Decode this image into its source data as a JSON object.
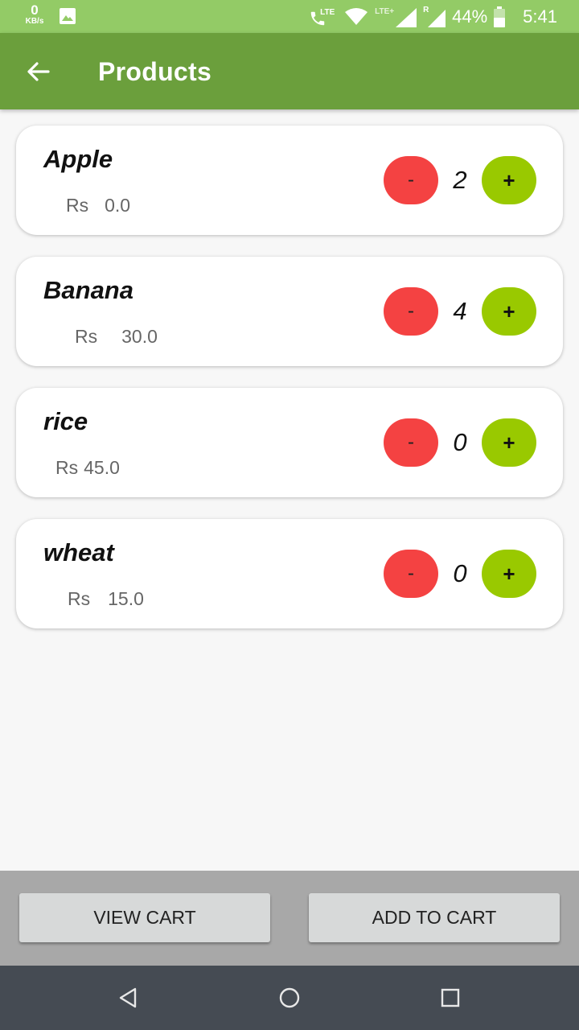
{
  "status_bar": {
    "kbs_value": "0",
    "kbs_unit": "KB/s",
    "lte_label": "LTE",
    "lte_plus_label": "LTE+",
    "roaming_label": "R",
    "battery": "44%",
    "time": "5:41",
    "icons": [
      "image-icon",
      "volte-call-icon",
      "wifi-icon",
      "signal-icon",
      "signal-roaming-icon",
      "battery-icon"
    ]
  },
  "app_bar": {
    "title": "Products",
    "back_icon": "arrow-left-icon"
  },
  "products": [
    {
      "name": "Apple",
      "currency": "Rs",
      "price": "0.0",
      "quantity": "2",
      "minus_label": "-",
      "plus_label": "+"
    },
    {
      "name": "Banana",
      "currency": "Rs",
      "price": "30.0",
      "quantity": "4",
      "minus_label": "-",
      "plus_label": "+"
    },
    {
      "name": "rice",
      "currency": "Rs",
      "price": "45.0",
      "quantity": "0",
      "minus_label": "-",
      "plus_label": "+"
    },
    {
      "name": "wheat",
      "currency": "Rs",
      "price": "15.0",
      "quantity": "0",
      "minus_label": "-",
      "plus_label": "+"
    }
  ],
  "actions": {
    "view_cart": "VIEW CART",
    "add_to_cart": "ADD TO CART"
  },
  "colors": {
    "status_bar": "#93cb66",
    "app_bar": "#6b9f3c",
    "minus_button": "#f44242",
    "plus_button": "#99c900",
    "bottom_bar": "#a8a8a8",
    "nav_bar": "#454b53"
  }
}
